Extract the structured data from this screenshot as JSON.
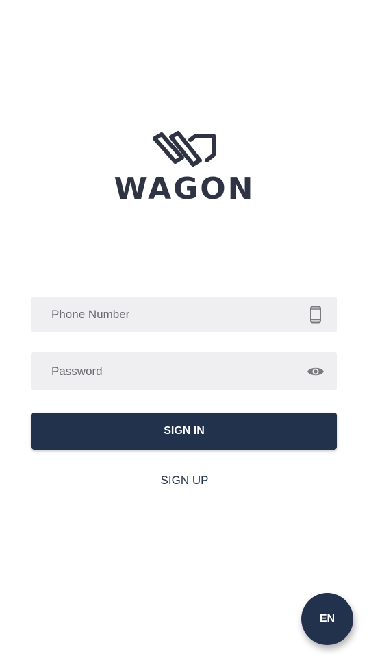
{
  "app": {
    "logo_text": "WAGON"
  },
  "form": {
    "phone_placeholder": "Phone Number",
    "password_placeholder": "Password",
    "phone_icon": "phone-icon",
    "password_icon": "eye-icon",
    "sign_in_label": "SIGN IN",
    "sign_up_label": "SIGN UP"
  },
  "language": {
    "current": "EN"
  },
  "colors": {
    "primary": "#22324d",
    "field_bg": "#efeef0",
    "logo": "#2f3445"
  }
}
